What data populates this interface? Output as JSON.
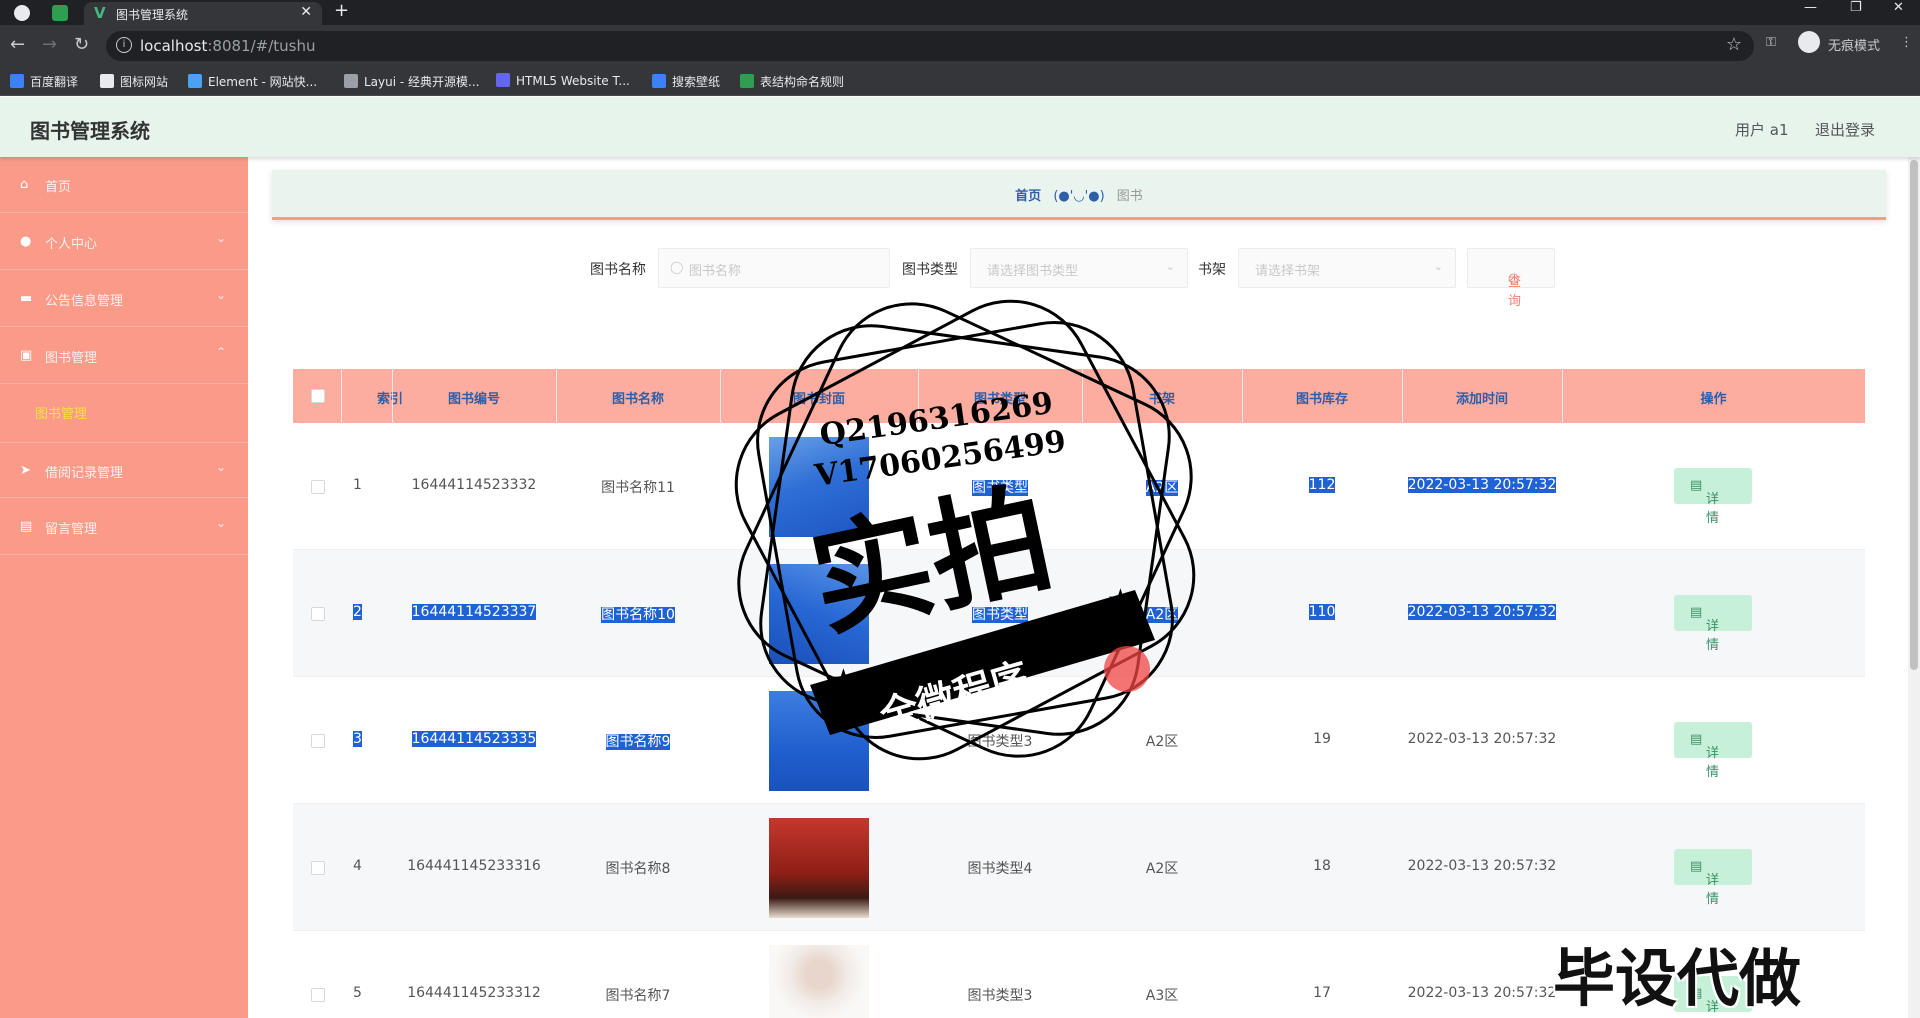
{
  "browser": {
    "tab_title": "图书管理系统",
    "url_host": "localhost",
    "url_rest": ":8081/#/tushu",
    "incognito_label": "无痕模式",
    "bookmarks": [
      "百度翻译",
      "图标网站",
      "Element - 网站快...",
      "Layui - 经典开源模...",
      "HTML5 Website T...",
      "搜索壁纸",
      "表结构命名规则"
    ]
  },
  "header": {
    "title": "图书管理系统",
    "user": "用户 a1",
    "logout": "退出登录"
  },
  "sidebar": {
    "items": [
      {
        "label": "首页",
        "icon": "home-icon"
      },
      {
        "label": "个人中心",
        "icon": "user-icon"
      },
      {
        "label": "公告信息管理",
        "icon": "briefcase-icon"
      },
      {
        "label": "图书管理",
        "icon": "book-icon"
      },
      {
        "label": "借阅记录管理",
        "icon": "send-icon"
      },
      {
        "label": "留言管理",
        "icon": "message-icon"
      }
    ],
    "sub_item": "图书管理"
  },
  "breadcrumb": {
    "home": "首页",
    "sep": "(●'◡'●)",
    "current": "图书"
  },
  "search": {
    "name_label": "图书名称",
    "name_placeholder": "图书名称",
    "type_label": "图书类型",
    "type_placeholder": "请选择图书类型",
    "shelf_label": "书架",
    "shelf_placeholder": "请选择书架",
    "query_button": "查询"
  },
  "table": {
    "headers": [
      "索引",
      "图书编号",
      "图书名称",
      "图书封面",
      "图书类型",
      "书架",
      "图书库存",
      "添加时间",
      "操作"
    ],
    "detail_label": "详情",
    "rows": [
      {
        "index": "1",
        "code": "16444114523332",
        "name": "图书名称11",
        "type": "图书类型",
        "shelf": "A2区",
        "stock": "112",
        "time": "2022-03-13 20:57:32"
      },
      {
        "index": "2",
        "code": "16444114523337",
        "name": "图书名称10",
        "type": "图书类型",
        "shelf": "A2区",
        "stock": "110",
        "time": "2022-03-13 20:57:32"
      },
      {
        "index": "3",
        "code": "16444114523335",
        "name": "图书名称9",
        "type": "图书类型3",
        "shelf": "A2区",
        "stock": "19",
        "time": "2022-03-13 20:57:32"
      },
      {
        "index": "4",
        "code": "164441145233316",
        "name": "图书名称8",
        "type": "图书类型4",
        "shelf": "A2区",
        "stock": "18",
        "time": "2022-03-13 20:57:32"
      },
      {
        "index": "5",
        "code": "164441145233312",
        "name": "图书名称7",
        "type": "图书类型3",
        "shelf": "A3区",
        "stock": "17",
        "time": "2022-03-13 20:57:32"
      }
    ]
  },
  "watermark": {
    "line1": "Q2196316269",
    "line2": "V17060256499",
    "big": "实拍",
    "banner": "全微程序",
    "corner": "毕设代做"
  }
}
